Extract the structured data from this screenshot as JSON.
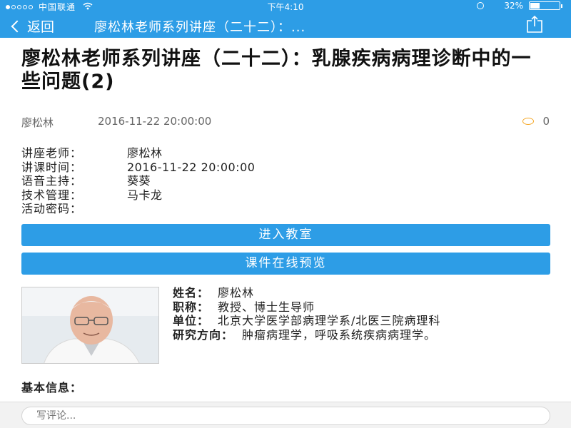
{
  "status_bar": {
    "carrier": "中国联通",
    "time": "下午4:10",
    "battery_text": "32%",
    "battery_level": 0.32
  },
  "nav": {
    "back_label": "返回",
    "title": "廖松林老师系列讲座（二十二）：...",
    "share_icon": "share-icon"
  },
  "article": {
    "title": "廖松林老师系列讲座（二十二）：乳腺疾病病理诊断中的一些问题(2)",
    "author": "廖松林",
    "date": "2016-11-22 20:00:00",
    "comment_count": "0"
  },
  "info": [
    {
      "label": "讲座老师：",
      "value": "廖松林"
    },
    {
      "label": "讲课时间：",
      "value": "2016-11-22 20:00:00"
    },
    {
      "label": "语音主持：",
      "value": "葵葵"
    },
    {
      "label": "技术管理：",
      "value": "马卡龙"
    },
    {
      "label": "活动密码：",
      "value": ""
    }
  ],
  "buttons": {
    "enter_classroom": "进入教室",
    "preview_courseware": "课件在线预览"
  },
  "profile": {
    "name_label": "姓名：",
    "name_value": "廖松林",
    "title_label": "职称：",
    "title_value": "教授、博士生导师",
    "unit_label": "单位：",
    "unit_value": "北京大学医学部病理学系/北医三院病理科",
    "research_label": "研究方向：",
    "research_value": "肿瘤病理学，呼吸系统疾病病理学。"
  },
  "basic_info_label": "基本信息：",
  "comment": {
    "placeholder": "写评论..."
  },
  "colors": {
    "accent": "#2d9de6",
    "comment_icon": "#f5a623"
  }
}
